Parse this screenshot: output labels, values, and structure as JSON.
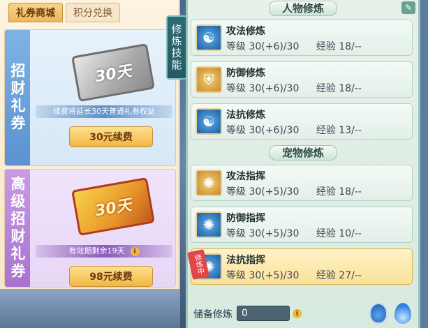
{
  "shop": {
    "tabs": [
      {
        "label": "礼券商城",
        "active": true
      },
      {
        "label": "积分兑换",
        "active": false
      }
    ],
    "cards": [
      {
        "title": "招财礼券",
        "ticket_text": "30天",
        "note": "续费将延长30天普通礼券权益",
        "button": "30元续费"
      },
      {
        "title": "高级招财礼券",
        "ticket_text": "30天",
        "note": "有效期剩余19天",
        "button": "98元续费"
      }
    ]
  },
  "side_tab": {
    "label": "修炼技能"
  },
  "panel": {
    "sections": [
      {
        "header": "人物修炼",
        "items": [
          {
            "name": "攻法修炼",
            "level_label": "等级",
            "level": "30(+6)/30",
            "exp_label": "经验",
            "exp": "18/--",
            "icon": "person-meditate-icon"
          },
          {
            "name": "防御修炼",
            "level_label": "等级",
            "level": "30(+6)/30",
            "exp_label": "经验",
            "exp": "18/--",
            "icon": "shield-icon"
          },
          {
            "name": "法抗修炼",
            "level_label": "等级",
            "level": "30(+6)/30",
            "exp_label": "经验",
            "exp": "13/--",
            "icon": "yin-yang-shield-icon"
          }
        ]
      },
      {
        "header": "宠物修炼",
        "items": [
          {
            "name": "攻法指挥",
            "level_label": "等级",
            "level": "30(+5)/30",
            "exp_label": "经验",
            "exp": "18/--",
            "icon": "paw-icon"
          },
          {
            "name": "防御指挥",
            "level_label": "等级",
            "level": "30(+5)/30",
            "exp_label": "经验",
            "exp": "10/--",
            "icon": "paw-shield-icon"
          },
          {
            "name": "法抗指挥",
            "level_label": "等级",
            "level": "30(+5)/30",
            "exp_label": "经验",
            "exp": "27/--",
            "icon": "paw-magic-icon",
            "badge": "修炼中",
            "selected": true
          }
        ]
      }
    ],
    "footer": {
      "label": "储备修炼",
      "value": "0"
    }
  },
  "colors": {
    "accent_gold": "#f2b744",
    "selected_row": "#f9e19a",
    "panel_bg": "#e6f1ea",
    "badge_red": "#e0474b"
  }
}
